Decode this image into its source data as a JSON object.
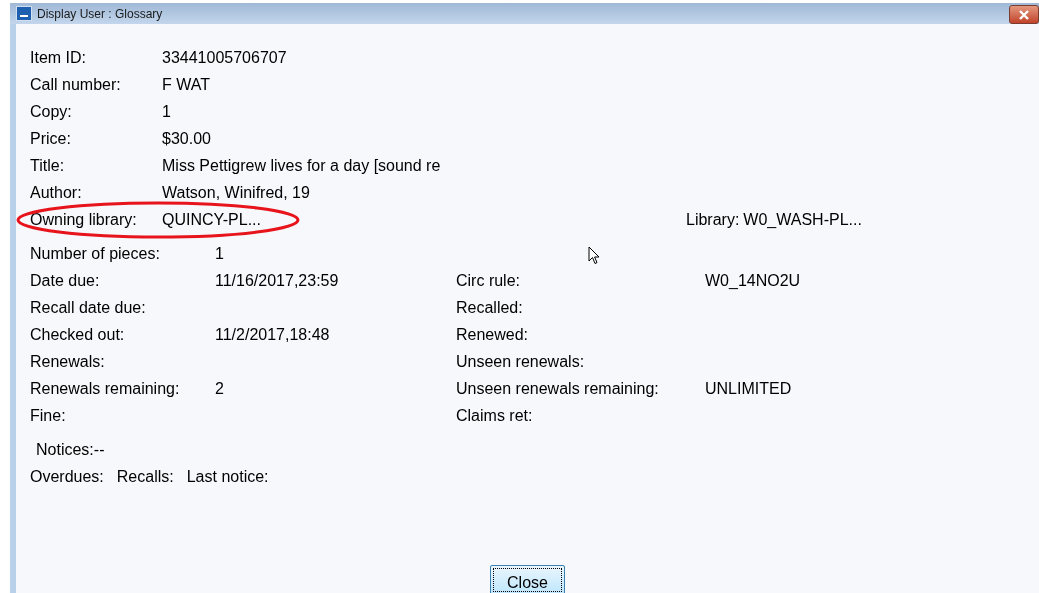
{
  "window": {
    "title": "Display User : Glossary"
  },
  "item_fields": [
    {
      "label": "Item ID:",
      "value": "33441005706707"
    },
    {
      "label": "Call number:",
      "value": "F WAT"
    },
    {
      "label": "Copy:",
      "value": "1"
    },
    {
      "label": "Price:",
      "value": "$30.00"
    },
    {
      "label": "Title:",
      "value": "Miss Pettigrew lives for a day [sound re"
    },
    {
      "label": "Author:",
      "value": "Watson, Winifred, 19"
    }
  ],
  "owning_library": {
    "label": "Owning library:",
    "value": "QUINCY-PL...",
    "circled": true
  },
  "library": {
    "label": "Library:",
    "value": "W0_WASH-PL..."
  },
  "circ_rows": [
    {
      "label": "Number of pieces:",
      "value": "1"
    },
    {
      "label": "Date due:",
      "value": "11/16/2017,23:59",
      "right_label": "Circ rule:",
      "right_value": "W0_14NO2U"
    },
    {
      "label": "Recall date due:",
      "right_label": "Recalled:"
    },
    {
      "label": "Checked out:",
      "value": "11/2/2017,18:48",
      "right_label": "Renewed:"
    },
    {
      "label": "Renewals:",
      "right_label": "Unseen renewals:"
    },
    {
      "label": "Renewals remaining:",
      "value": "2",
      "right_label": "Unseen renewals remaining:",
      "right_value": "UNLIMITED"
    },
    {
      "label": "Fine:",
      "right_label": "Claims ret:"
    }
  ],
  "notices": {
    "label": "Notices:--"
  },
  "notice_counts": [
    "Overdues:",
    "Recalls:",
    "Last notice:"
  ],
  "close_button": "Close"
}
